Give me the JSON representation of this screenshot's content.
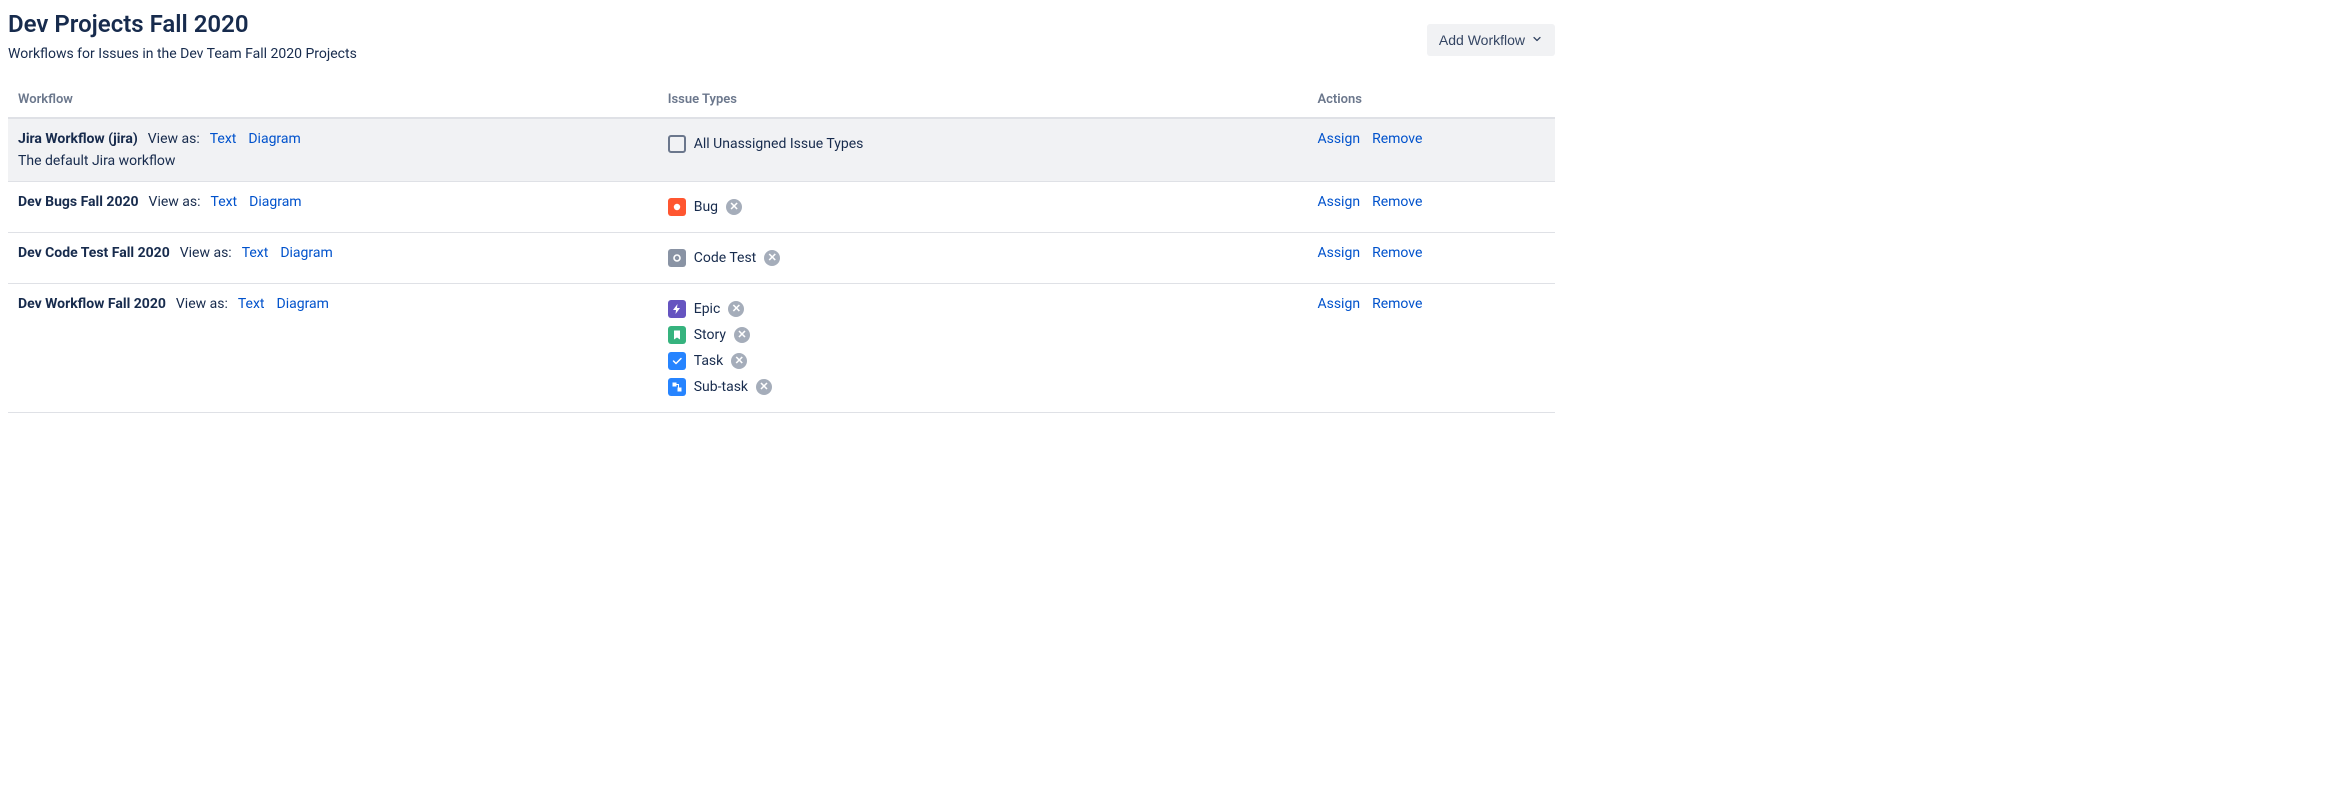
{
  "header": {
    "title": "Dev Projects Fall 2020",
    "description": "Workflows for Issues in the Dev Team Fall 2020 Projects",
    "add_workflow_label": "Add Workflow"
  },
  "columns": {
    "workflow": "Workflow",
    "issue_types": "Issue Types",
    "actions": "Actions"
  },
  "labels": {
    "view_as": "View as:",
    "text": "Text",
    "diagram": "Diagram",
    "assign": "Assign",
    "remove": "Remove"
  },
  "rows": [
    {
      "name": "Jira Workflow (jira)",
      "subtitle": "The default Jira workflow",
      "highlight": true,
      "types": [
        {
          "icon": "unassigned",
          "label": "All Unassigned Issue Types",
          "removable": false
        }
      ]
    },
    {
      "name": "Dev Bugs Fall 2020",
      "subtitle": "",
      "highlight": false,
      "types": [
        {
          "icon": "bug",
          "label": "Bug",
          "removable": true
        }
      ]
    },
    {
      "name": "Dev Code Test Fall 2020",
      "subtitle": "",
      "highlight": false,
      "types": [
        {
          "icon": "code",
          "label": "Code Test",
          "removable": true
        }
      ]
    },
    {
      "name": "Dev Workflow Fall 2020",
      "subtitle": "",
      "highlight": false,
      "types": [
        {
          "icon": "epic",
          "label": "Epic",
          "removable": true
        },
        {
          "icon": "story",
          "label": "Story",
          "removable": true
        },
        {
          "icon": "task",
          "label": "Task",
          "removable": true
        },
        {
          "icon": "subtask",
          "label": "Sub-task",
          "removable": true
        }
      ]
    }
  ]
}
